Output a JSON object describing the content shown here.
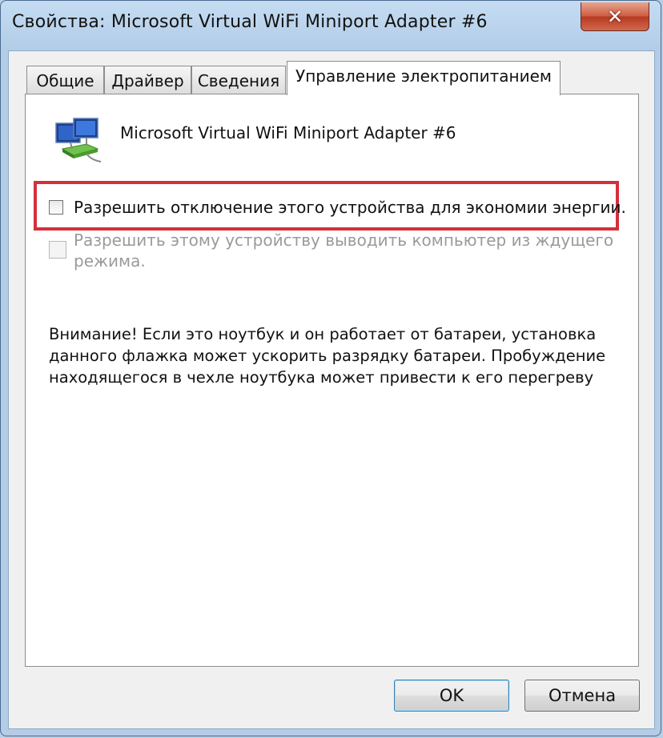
{
  "window": {
    "title": "Свойства: Microsoft Virtual WiFi Miniport Adapter #6",
    "close_symbol": "✕"
  },
  "tabs": [
    {
      "label": "Общие",
      "active": false
    },
    {
      "label": "Драйвер",
      "active": false
    },
    {
      "label": "Сведения",
      "active": false
    },
    {
      "label": "Управление электропитанием",
      "active": true
    }
  ],
  "panel": {
    "icon": "network-adapter-icon",
    "adapter_name": "Microsoft Virtual WiFi Miniport Adapter #6",
    "options": [
      {
        "label": "Разрешить отключение этого устройства для экономии энергии.",
        "checked": false,
        "enabled": true,
        "highlighted": true
      },
      {
        "label": "Разрешить этому устройству выводить компьютер из ждущего режима.",
        "checked": false,
        "enabled": false,
        "highlighted": false
      }
    ],
    "option2_lines": [
      "Разрешить этому устройству выводить компьютер из ждущего",
      "режима."
    ],
    "warning_lines": [
      "Внимание! Если это ноутбук и он работает от батареи, установка",
      "данного флажка может ускорить разрядку батареи. Пробуждение",
      "находящегося в чехле ноутбука может привести к его перегреву"
    ],
    "highlight_color": "#d4303a"
  },
  "buttons": {
    "ok": "OK",
    "cancel": "Отмена"
  }
}
